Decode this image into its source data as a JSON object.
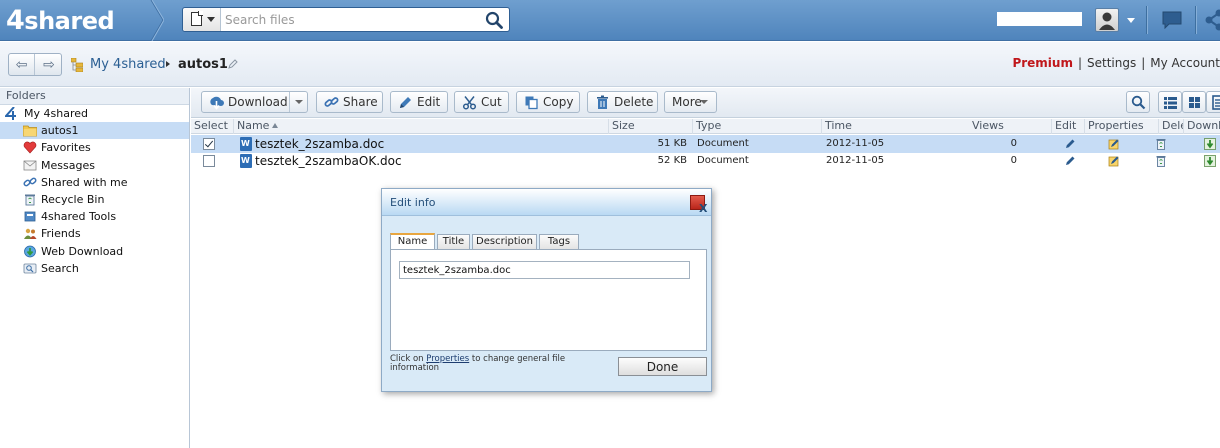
{
  "header": {
    "logo_num": "4",
    "logo_text": "shared",
    "search": {
      "placeholder": "Search files",
      "value": ""
    },
    "icons": [
      "document-type-icon",
      "search-icon",
      "avatar-icon",
      "chat-icon",
      "share-icon"
    ]
  },
  "nav": {
    "root": "My 4shared",
    "current": "autos1",
    "links": {
      "premium": "Premium",
      "settings": "Settings",
      "account": "My Account"
    }
  },
  "sidebar": {
    "header": "Folders",
    "items": [
      {
        "label": "My 4shared",
        "icon": "4shared-icon"
      },
      {
        "label": "autos1",
        "icon": "folder-icon",
        "selected": true
      },
      {
        "label": "Favorites",
        "icon": "heart-icon"
      },
      {
        "label": "Messages",
        "icon": "envelope-icon"
      },
      {
        "label": "Shared with me",
        "icon": "link-icon"
      },
      {
        "label": "Recycle Bin",
        "icon": "recycle-bin-icon"
      },
      {
        "label": "4shared Tools",
        "icon": "tools-icon"
      },
      {
        "label": "Friends",
        "icon": "friends-icon"
      },
      {
        "label": "Web Download",
        "icon": "globe-download-icon"
      },
      {
        "label": "Search",
        "icon": "search-icon"
      }
    ]
  },
  "toolbar": {
    "download": "Download",
    "share": "Share",
    "edit": "Edit",
    "cut": "Cut",
    "copy": "Copy",
    "delete": "Delete",
    "more": "More"
  },
  "table": {
    "columns": {
      "select": "Select",
      "name": "Name",
      "size": "Size",
      "type": "Type",
      "time": "Time",
      "views": "Views",
      "edit": "Edit",
      "properties": "Properties",
      "delete": "Delete",
      "download": "Downlo"
    },
    "rows": [
      {
        "name": "tesztek_2szamba.doc",
        "size": "51 KB",
        "type": "Document",
        "time": "2012-11-05",
        "views": "0",
        "checked": true
      },
      {
        "name": "tesztek_2szambaOK.doc",
        "size": "52 KB",
        "type": "Document",
        "time": "2012-11-05",
        "views": "0",
        "checked": false
      }
    ]
  },
  "dialog": {
    "title": "Edit info",
    "close": "X",
    "tabs": [
      "Name",
      "Title",
      "Description",
      "Tags"
    ],
    "active_tab": "Name",
    "name_value": "tesztek_2szamba.doc",
    "hint_pre": "Click on ",
    "hint_link": "Properties",
    "hint_post": " to change general file information",
    "done": "Done"
  },
  "colors": {
    "header_blue": "#5a8ec4",
    "premium_red": "#c0171b",
    "selection": "#c6dcf5",
    "link": "#2b5f93"
  }
}
